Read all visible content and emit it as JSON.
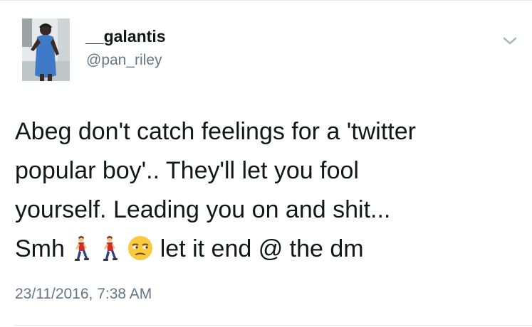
{
  "tweet": {
    "author": {
      "display_name": "__galantis",
      "handle": "@pan_riley"
    },
    "text_lines": [
      "Abeg don't catch feelings for a 'twitter",
      "popular boy'.. They'll  let you fool",
      "yourself. Leading you on and shit..."
    ],
    "last_line": {
      "prefix": "Smh",
      "suffix": "let it end @ the dm"
    },
    "emojis": [
      "person-walking-emoji",
      "person-walking-emoji",
      "unamused-face-emoji"
    ],
    "timestamp": "23/11/2016, 7:38 AM"
  },
  "icons": {
    "menu": "chevron-down-icon"
  },
  "colors": {
    "text": "#14171a",
    "secondary": "#657786",
    "divider": "#e1e8ed"
  }
}
